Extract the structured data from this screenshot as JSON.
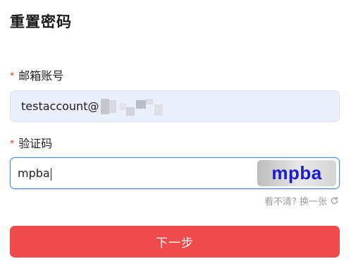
{
  "page": {
    "title": "重置密码"
  },
  "form": {
    "required_mark": "*",
    "email": {
      "label": "邮箱账号",
      "value": "testaccount@"
    },
    "code": {
      "label": "验证码",
      "value": "mpba",
      "captcha_text": "mpba",
      "captcha_text_color": "#1a1ad6"
    },
    "refresh_text": "看不清? 换一张",
    "refresh_icon": "refresh-icon",
    "submit_label": "下一步",
    "submit_color": "#ef4b4b",
    "required_color": "#e84a4a"
  }
}
